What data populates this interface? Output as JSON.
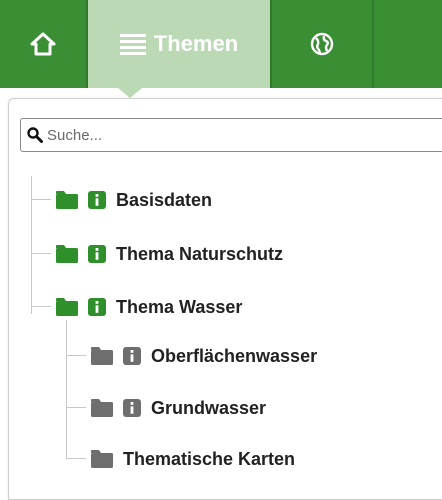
{
  "toolbar": {
    "home_icon": "home-icon",
    "themen_icon": "list-icon",
    "themen_label": "Themen",
    "globe_icon": "globe-icon",
    "colors": {
      "bar": "#3a8f35",
      "active_tab": "#bcd9b6"
    }
  },
  "search": {
    "placeholder": "Suche..."
  },
  "tree": {
    "items": [
      {
        "label": "Basisdaten",
        "level": 0,
        "info": true,
        "active": true
      },
      {
        "label": "Thema Naturschutz",
        "level": 0,
        "info": true,
        "active": true
      },
      {
        "label": "Thema Wasser",
        "level": 0,
        "info": true,
        "active": true
      },
      {
        "label": "Oberflächenwasser",
        "level": 1,
        "info": true,
        "active": false
      },
      {
        "label": "Grundwasser",
        "level": 1,
        "info": true,
        "active": false
      },
      {
        "label": "Thematische Karten",
        "level": 1,
        "info": false,
        "active": false
      }
    ],
    "colors": {
      "active": "#2f8f2a",
      "inactive": "#6e6e6e"
    }
  }
}
